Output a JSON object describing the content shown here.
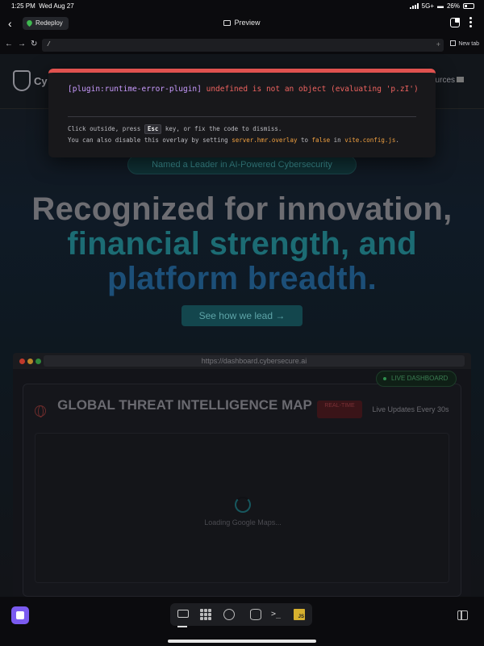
{
  "status_bar": {
    "time": "1:25 PM",
    "date": "Wed Aug 27",
    "network": "5G+",
    "battery": "26%"
  },
  "app_bar": {
    "redeploy_label": "Redeploy",
    "title": "Preview"
  },
  "url_bar": {
    "path": "/",
    "plus": "+",
    "new_tab_label": "New tab"
  },
  "error_overlay": {
    "plugin": "[plugin:runtime-error-plugin]",
    "message": "undefined is not an object (evaluating 'p.zI')",
    "tip1_a": "Click outside, press ",
    "tip1_key": "Esc",
    "tip1_b": " key, or fix the code to dismiss.",
    "tip2_a": "You can also disable this overlay by setting ",
    "tip2_setting": "server.hmr.overlay",
    "tip2_b": " to ",
    "tip2_value": "false",
    "tip2_c": " in ",
    "tip2_file": "vite.config.js",
    "tip2_d": ".",
    "border_color": "#e0524f"
  },
  "site": {
    "logo_text": "Cy",
    "nav_right": "ources",
    "pill": "Named a Leader in AI-Powered Cybersecurity",
    "hero_line1": "Recognized for innovation,",
    "hero_line2": "financial strength, and",
    "hero_line3": "platform breadth.",
    "cta": "See how we lead  →",
    "dashboard_url": "https://dashboard.cybersecure.ai",
    "map_title": "GLOBAL THREAT INTELLIGENCE MAP",
    "realtime_badge": "REAL-TIME",
    "live_badge": "LIVE DASHBOARD",
    "live_updates": "Live Updates Every 30s",
    "loading": "Loading Google Maps..."
  },
  "bottom_bar": {
    "js_badge": "JS",
    "terminal_glyph": ">_",
    "icons": [
      "stop-icon",
      "monitor-icon",
      "grid-icon",
      "globe-icon",
      "database-icon",
      "terminal-icon",
      "javascript-icon",
      "side-panel-icon"
    ]
  },
  "colors": {
    "accent_purple": "#7b5bf0",
    "error_red": "#ef6360",
    "plugin_purple": "#c99bff",
    "highlight_orange": "#f0a040"
  }
}
